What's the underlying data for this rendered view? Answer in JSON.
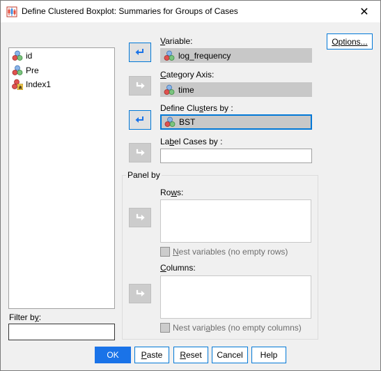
{
  "window": {
    "title": "Define Clustered Boxplot: Summaries for Groups of Cases",
    "close_glyph": "✕"
  },
  "variable_list": [
    {
      "name": "id",
      "icon": "scale-variable-icon"
    },
    {
      "name": "Pre",
      "icon": "scale-variable-icon"
    },
    {
      "name": "Index1",
      "icon": "nominal-string-variable-icon"
    }
  ],
  "variable": {
    "label": "Variable:",
    "value": "log_frequency"
  },
  "category_axis": {
    "label": "Category Axis:",
    "value": "time"
  },
  "define_clusters": {
    "label": "Define Clusters by :",
    "value": "BST"
  },
  "label_cases": {
    "label": "Label Cases by :",
    "value": ""
  },
  "panel_by": {
    "label": "Panel by",
    "rows_label": "Rows:",
    "nest_rows_label": "Nest variables (no empty rows)",
    "columns_label": "Columns:",
    "nest_columns_label": "Nest variables (no empty columns)"
  },
  "options_button": "Options...",
  "filter_by_label": "Filter by:",
  "buttons": {
    "ok": "OK",
    "paste": "Paste",
    "reset": "Reset",
    "cancel": "Cancel",
    "help": "Help"
  },
  "colors": {
    "accent": "#0078d7",
    "ok_button": "#1a73e8",
    "filled_slot": "#c8c8c8",
    "arrow_active": "#1a73e8"
  }
}
